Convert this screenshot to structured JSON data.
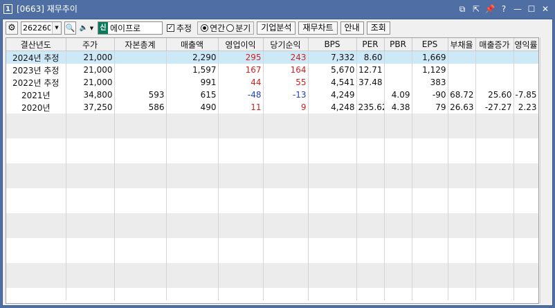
{
  "window": {
    "number": "1",
    "title": "[0663] 재무추이",
    "controls": [
      "⧉",
      "⇱",
      "📌",
      "?",
      "—",
      "☐",
      "✕"
    ]
  },
  "toolbar": {
    "code": "262260",
    "badge": "신",
    "stock_name": "에이프로",
    "estimate_label": "추정",
    "annual_label": "연간",
    "quarter_label": "분기",
    "btn_company": "기업분석",
    "btn_chart": "재무차트",
    "btn_guide": "안내",
    "btn_search": "조회"
  },
  "table": {
    "headers": [
      "결산년도",
      "주가",
      "자본총계",
      "매출액",
      "영업이익",
      "당기순익",
      "BPS",
      "PER",
      "PBR",
      "EPS",
      "부채율",
      "매출증가",
      "영익률"
    ],
    "rows": [
      {
        "year": "2024년  추정",
        "price": "21,000",
        "equity": "",
        "sales": "2,290",
        "op": "295",
        "net": "243",
        "bps": "7,332",
        "per": "8.60",
        "pbr": "",
        "eps": "1,669",
        "debt": "",
        "growth": "",
        "margin": ""
      },
      {
        "year": "2023년  추정",
        "price": "21,000",
        "equity": "",
        "sales": "1,597",
        "op": "167",
        "net": "164",
        "bps": "5,670",
        "per": "12.71",
        "pbr": "",
        "eps": "1,129",
        "debt": "",
        "growth": "",
        "margin": ""
      },
      {
        "year": "2022년  추정",
        "price": "21,000",
        "equity": "",
        "sales": "991",
        "op": "44",
        "net": "55",
        "bps": "4,541",
        "per": "37.48",
        "pbr": "",
        "eps": "383",
        "debt": "",
        "growth": "",
        "margin": ""
      },
      {
        "year": "2021년",
        "price": "34,800",
        "equity": "593",
        "sales": "615",
        "op": "-48",
        "net": "-13",
        "bps": "4,249",
        "per": "",
        "pbr": "4.09",
        "eps": "-90",
        "debt": "68.72",
        "growth": "25.60",
        "margin": "-7.85"
      },
      {
        "year": "2020년",
        "price": "37,250",
        "equity": "586",
        "sales": "490",
        "op": "11",
        "net": "9",
        "bps": "4,248",
        "per": "235.62",
        "pbr": "4.38",
        "eps": "79",
        "debt": "26.63",
        "growth": "-27.27",
        "margin": "2.23"
      }
    ]
  },
  "colors": {
    "title_bar": "#4f6fa4",
    "selected_row": "#cde8f6",
    "positive": "#d02020",
    "negative": "#2040c0",
    "badge": "#0a7a5a"
  }
}
